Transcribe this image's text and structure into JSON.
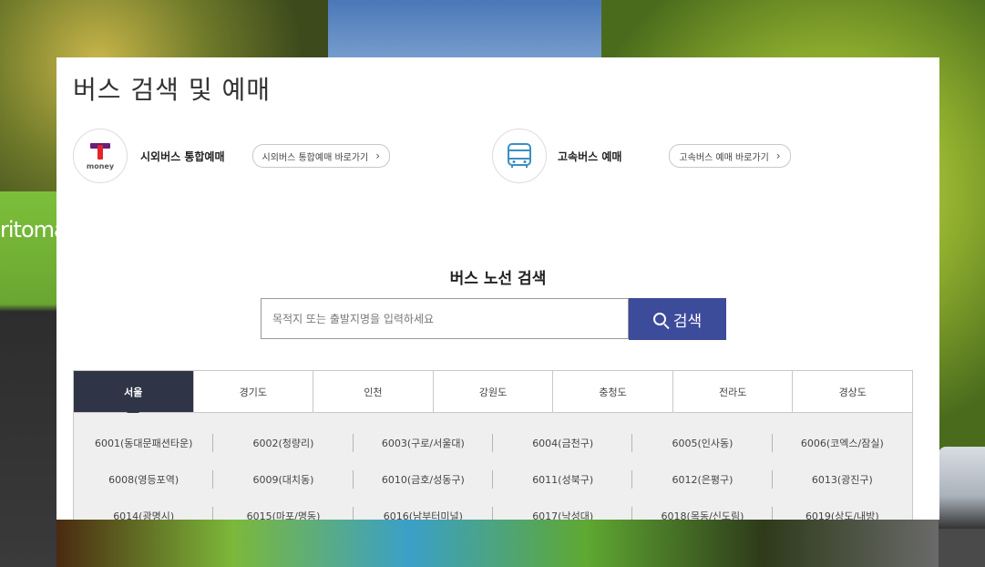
{
  "page_title": "버스 검색 및 예매",
  "intercity": {
    "logo_text": "money",
    "label": "시외버스 통합예매",
    "link": "시외버스 통합예매 바로가기"
  },
  "express": {
    "label": "고속버스 예매",
    "link": "고속버스 예매 바로가기"
  },
  "route_search": {
    "title": "버스 노선 검색",
    "placeholder": "목적지 또는 출발지명을 입력하세요",
    "button": "검색"
  },
  "background": {
    "bus_sign": "ritoma"
  },
  "tabs": [
    "서울",
    "경기도",
    "인천",
    "강원도",
    "충청도",
    "전라도",
    "경상도"
  ],
  "active_tab": "서울",
  "routes": [
    "6001(동대문패션타운)",
    "6002(청량리)",
    "6003(구로/서울대)",
    "6004(금천구)",
    "6005(인사동)",
    "6006(코엑스/잠실)",
    "6008(영등포역)",
    "6009(대치동)",
    "6010(금호/성동구)",
    "6011(성북구)",
    "6012(은평구)",
    "6013(광진구)",
    "6014(광명시)",
    "6015(마포/명동)",
    "6016(남부터미널)",
    "6017(낙성대)",
    "6018(목동/신도림)",
    "6019(상도/내방)"
  ],
  "colors": {
    "accent": "#3d4b9b",
    "active_tab": "#2f3546",
    "route_bg": "#efefef"
  }
}
